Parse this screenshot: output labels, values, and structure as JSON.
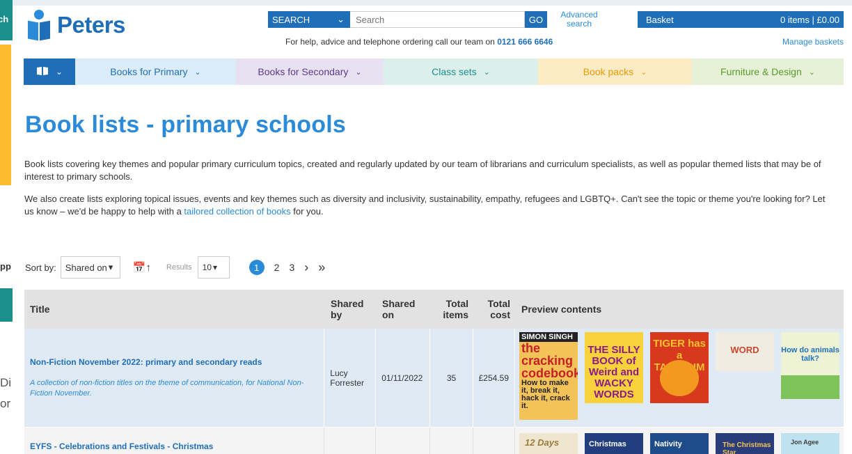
{
  "left_overlay": {
    "top_text": "rch",
    "mid_text": "pp",
    "line1": "Di",
    "line2": "or"
  },
  "header": {
    "logo_text": "Peters",
    "search": {
      "scope": "SEARCH",
      "placeholder": "Search",
      "go_label": "GO",
      "advanced_label": "Advanced search"
    },
    "basket": {
      "label": "Basket",
      "summary": "0 items | £0.00"
    },
    "help_text": "For help, advice and telephone ordering call our team on",
    "help_phone": "0121 666 6646",
    "manage_baskets": "Manage baskets"
  },
  "nav": {
    "items": [
      {
        "label": "Books for Primary"
      },
      {
        "label": "Books for Secondary"
      },
      {
        "label": "Class sets"
      },
      {
        "label": "Book packs"
      },
      {
        "label": "Furniture & Design"
      }
    ]
  },
  "page": {
    "title": "Book lists - primary schools",
    "intro1": "Book lists covering key themes and popular primary curriculum topics, created and regularly updated by our team of librarians and curriculum specialists, as well as popular themed lists that may be of interest to primary schools.",
    "intro2_pre": "We also create lists exploring topical issues, events and key themes such as diversity and inclusivity, sustainability, empathy, refugees and LGBTQ+. Can't see the topic or theme you're looking for? Let us know – we'd be happy to help with a",
    "intro2_link": "tailored collection of books",
    "intro2_post": "for you."
  },
  "sort": {
    "label": "Sort by:",
    "selected": "Shared on",
    "results_label": "Results",
    "results_selected": "10",
    "pages": [
      "1",
      "2",
      "3"
    ],
    "current_page": "1",
    "next_glyph": "›",
    "last_glyph": "»"
  },
  "table": {
    "headers": {
      "title": "Title",
      "shared_by": "Shared by",
      "shared_on": "Shared on",
      "total_items": "Total items",
      "total_cost": "Total cost",
      "preview": "Preview contents"
    },
    "rows": [
      {
        "title": "Non-Fiction November 2022: primary and secondary reads",
        "description": "A collection of non-fiction titles on the theme of communication, for National Non-Fiction November.",
        "shared_by": "Lucy Forrester",
        "shared_on": "01/11/2022",
        "total_items": "35",
        "total_cost": "£254.59",
        "covers": [
          {
            "author": "SIMON SINGH",
            "title": "the cracking codebook",
            "tagline": "How to make it, break it, hack it, crack it."
          },
          {
            "title": "THE SILLY BOOK of Weird and WACKY WORDS"
          },
          {
            "title": "TIGER has a TANTRUM"
          },
          {
            "title": "WORD"
          },
          {
            "title": "How do animals talk?"
          }
        ]
      },
      {
        "title": "EYFS - Celebrations and Festivals - Christmas",
        "description": "",
        "shared_by": "",
        "shared_on": "",
        "total_items": "",
        "total_cost": "",
        "covers": [
          {
            "title": "12 Days"
          },
          {
            "title": "Christmas"
          },
          {
            "title": "Nativity"
          },
          {
            "title": "The Christmas Star"
          },
          {
            "title": "Jon Agee"
          }
        ]
      }
    ]
  }
}
